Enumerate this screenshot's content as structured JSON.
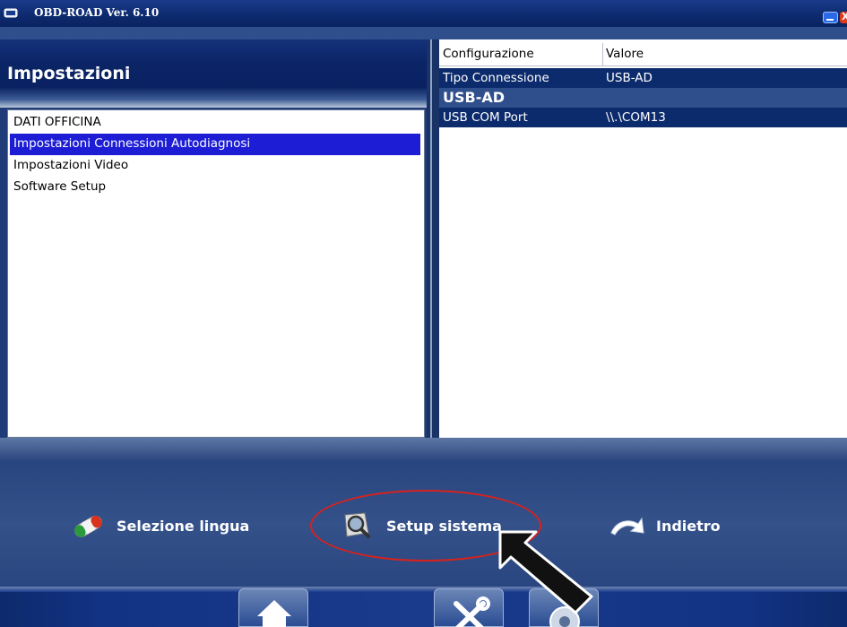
{
  "window": {
    "title": "OBD-ROAD Ver.  6.10",
    "close_glyph": "X"
  },
  "left_panel": {
    "heading": "Impostazioni",
    "items": [
      {
        "label": "DATI OFFICINA",
        "selected": false
      },
      {
        "label": "Impostazioni Connessioni Autodiagnosi",
        "selected": true
      },
      {
        "label": "Impostazioni Video",
        "selected": false
      },
      {
        "label": "Software Setup",
        "selected": false
      }
    ]
  },
  "config_grid": {
    "columns": [
      "Configurazione",
      "Valore"
    ],
    "rows": [
      {
        "name": "Tipo Connessione",
        "value": "USB-AD"
      }
    ],
    "group_label": "USB-AD",
    "group_rows": [
      {
        "name": "USB COM Port",
        "value": "\\\\.\\COM13"
      }
    ]
  },
  "actions": {
    "language_label": "Selezione lingua",
    "setup_label": "Setup sistema",
    "back_label": "Indietro"
  },
  "footer_tabs": [
    "home-icon",
    "tools-icon",
    "disc-icon"
  ],
  "colors": {
    "selection": "#1d1dd6",
    "grid_row": "#0c2b6c",
    "annotation_circle": "#d8221c"
  }
}
